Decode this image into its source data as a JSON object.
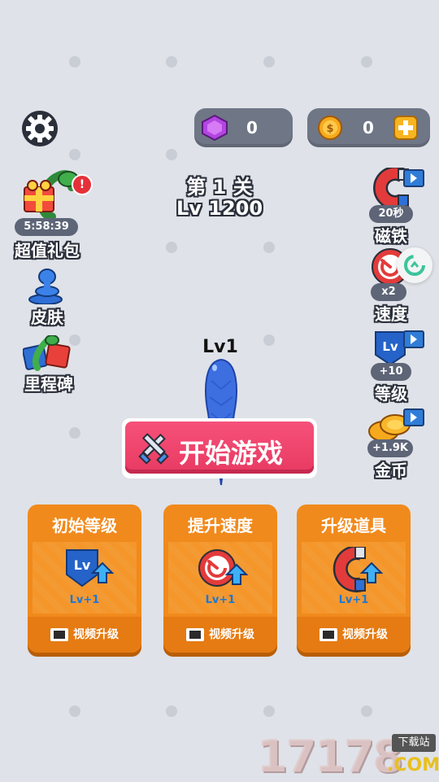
{
  "currency": {
    "gems": "0",
    "coins": "0"
  },
  "level": {
    "stage": "第 1 关",
    "lv": "Lv 1200"
  },
  "left_menu": {
    "gift_timer": "5:58:39",
    "gift_label": "超值礼包",
    "skins_label": "皮肤",
    "milestone_label": "里程碑"
  },
  "right_menu": {
    "magnet": {
      "badge": "20秒",
      "label": "磁铁"
    },
    "speed": {
      "badge": "x2",
      "label": "速度"
    },
    "level": {
      "badge": "+10",
      "label": "等级"
    },
    "coins": {
      "badge": "+1.9K",
      "label": "金币"
    }
  },
  "player": {
    "label": "Lv1"
  },
  "start_button": {
    "label": "开始游戏"
  },
  "upgrades": [
    {
      "title": "初始等级",
      "level": "Lv+1",
      "action": "视频升级"
    },
    {
      "title": "提升速度",
      "level": "Lv+1",
      "action": "视频升级"
    },
    {
      "title": "升级道具",
      "level": "Lv+1",
      "action": "视频升级"
    }
  ],
  "watermark": {
    "number": "17178",
    "badge": "下载站",
    "domain": ".COM"
  },
  "colors": {
    "accent_pink": "#e83a62",
    "card_orange": "#f08a1c",
    "hud_gray": "#6f7686"
  }
}
